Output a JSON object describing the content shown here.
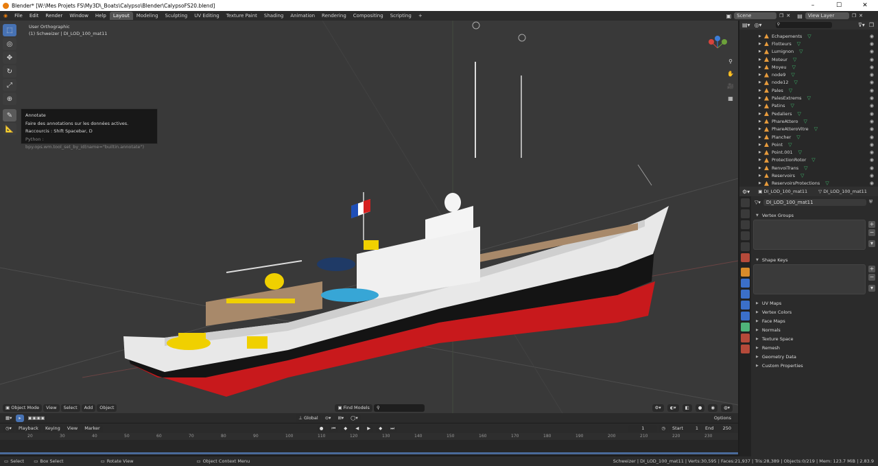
{
  "window": {
    "title": "Blender* [W:\\Mes Projets FS\\My3D\\_Boats\\Calypso\\Blender\\CalypsoFS20.blend]"
  },
  "menu": [
    "File",
    "Edit",
    "Render",
    "Window",
    "Help"
  ],
  "workspaces": [
    "Layout",
    "Modeling",
    "Sculpting",
    "UV Editing",
    "Texture Paint",
    "Shading",
    "Animation",
    "Rendering",
    "Compositing",
    "Scripting"
  ],
  "active_workspace": "Layout",
  "scene": {
    "name": "Scene",
    "view_layer": "View Layer"
  },
  "viewport": {
    "view_name": "User Orthographic",
    "object_info": "(1) Schweizer | DI_LOD_100_mat11",
    "mode": "Object Mode",
    "menus": [
      "View",
      "Select",
      "Add",
      "Object"
    ],
    "find_models": "Find Models",
    "transform_orientation": "Global",
    "options_label": "Options"
  },
  "tooltip": {
    "title": "Annotate",
    "description": "Faire des annotations sur les données actives.",
    "shortcut": "Raccourcis : Shift Spacebar, D",
    "python": "Python :  bpy.ops.wm.tool_set_by_id(name=\"builtin.annotate\")"
  },
  "timeline": {
    "menus": [
      "Playback",
      "Keying",
      "View",
      "Marker"
    ],
    "current_frame": "1",
    "start_label": "Start",
    "start": "1",
    "end_label": "End",
    "end": "250",
    "ticks": [
      "20",
      "30",
      "40",
      "50",
      "60",
      "70",
      "80",
      "90",
      "100",
      "110",
      "120",
      "130",
      "140",
      "150",
      "160",
      "170",
      "180",
      "190",
      "200",
      "210",
      "220",
      "230"
    ]
  },
  "outliner": {
    "items": [
      "Echapements",
      "Flotteurs",
      "Lumignon",
      "Moteur",
      "Moyeu",
      "node9",
      "node12",
      "Pales",
      "PalesExtrems",
      "Patins",
      "Pedaliers",
      "PhareAttero",
      "PhareAtteroVitre",
      "Plancher",
      "Point",
      "Point.001",
      "ProtectionRotor",
      "RenvoiTrans",
      "Reservoirs",
      "ReservoirsProtections"
    ]
  },
  "properties": {
    "object_name": "DI_LOD_100_mat11",
    "mesh_name": "DI_LOD_100_mat11",
    "data_name": "DI_LOD_100_mat11",
    "panels_open": [
      "Vertex Groups",
      "Shape Keys"
    ],
    "panels_closed": [
      "UV Maps",
      "Vertex Colors",
      "Face Maps",
      "Normals",
      "Texture Space",
      "Remesh",
      "Geometry Data",
      "Custom Properties"
    ]
  },
  "status": {
    "select": "Select",
    "box_select": "Box Select",
    "rotate_view": "Rotate View",
    "context_menu": "Object Context Menu",
    "stats": "Schweizer | DI_LOD_100_mat11 | Verts:30,595 | Faces:21,937 | Tris:28,389 | Objects:0/219 | Mem: 123.7 MiB | 2.83.9"
  },
  "colors": {
    "accent": "#4772b3",
    "hull_red": "#c8191c",
    "hull_black": "#141414",
    "hull_white": "#e8e8e8",
    "deck": "#a8896a",
    "yellow": "#f0d000"
  }
}
